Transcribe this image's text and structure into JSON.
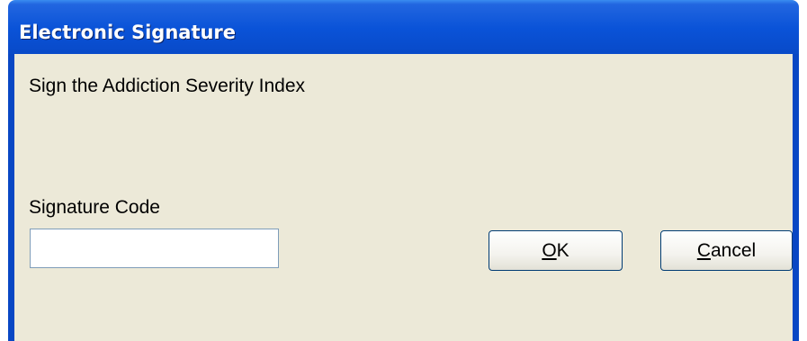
{
  "window": {
    "title": "Electronic Signature"
  },
  "dialog": {
    "prompt": "Sign the Addiction Severity Index",
    "signature_label": "Signature Code",
    "signature_value": ""
  },
  "buttons": {
    "ok": {
      "mnemonic": "O",
      "rest": "K"
    },
    "cancel": {
      "mnemonic": "C",
      "rest": "ancel"
    }
  },
  "colors": {
    "titlebar": "#0847c4",
    "client_bg": "#ece9d8",
    "title_text": "#ffffff"
  }
}
